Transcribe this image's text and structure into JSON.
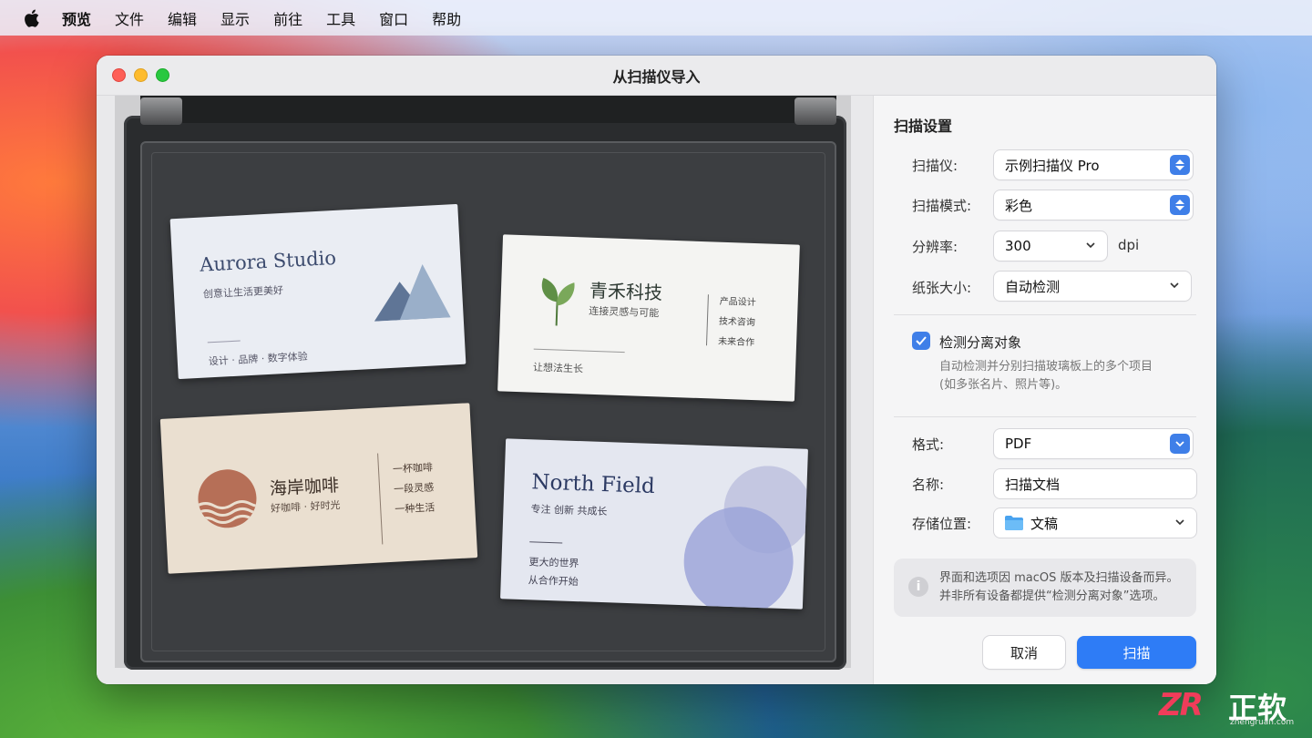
{
  "menubar": {
    "app_name": "预览",
    "items": [
      "文件",
      "编辑",
      "显示",
      "前往",
      "工具",
      "窗口",
      "帮助"
    ]
  },
  "window": {
    "title": "从扫描仪导入"
  },
  "cards": {
    "card1": {
      "title": "Aurora Studio",
      "subtitle": "创意让生活更美好",
      "footer": "设计 · 品牌 · 数字体验"
    },
    "card2": {
      "title": "青禾科技",
      "subtitle": "连接灵感与可能",
      "right": [
        "产品设计",
        "技术咨询",
        "未来合作"
      ],
      "footer": "让想法生长"
    },
    "card3": {
      "title": "海岸咖啡",
      "subtitle": "好咖啡 · 好时光",
      "right": [
        "一杯咖啡",
        "一段灵感",
        "一种生活"
      ]
    },
    "card4": {
      "title": "North Field",
      "subtitle": "专注   创新   共成长",
      "footer1": "更大的世界",
      "footer2": "从合作开始"
    }
  },
  "settings": {
    "title": "扫描设置",
    "scanner": {
      "label": "扫描仪:",
      "value": "示例扫描仪 Pro"
    },
    "mode": {
      "label": "扫描模式:",
      "value": "彩色"
    },
    "resolution": {
      "label": "分辨率:",
      "value": "300",
      "unit": "dpi"
    },
    "paper": {
      "label": "纸张大小:",
      "value": "自动检测"
    },
    "detect": {
      "label": "检测分离对象",
      "checked": true,
      "desc1": "自动检测并分别扫描玻璃板上的多个项目",
      "desc2": "(如多张名片、照片等)。"
    },
    "format": {
      "label": "格式:",
      "value": "PDF"
    },
    "name": {
      "label": "名称:",
      "value": "扫描文档"
    },
    "location": {
      "label": "存储位置:",
      "value": "文稿"
    },
    "info": {
      "line1": "界面和选项因 macOS 版本及扫描设备而异。",
      "line2": "并非所有设备都提供“检测分离对象”选项。"
    },
    "cancel_label": "取消",
    "scan_label": "扫描"
  },
  "watermark": {
    "logo": "ZR",
    "name": "正软",
    "url": "zhengruan.com"
  },
  "colors": {
    "accent": "#2e7cf6",
    "close": "#fe5f57",
    "minimize": "#febc2e",
    "zoom": "#28c840"
  }
}
